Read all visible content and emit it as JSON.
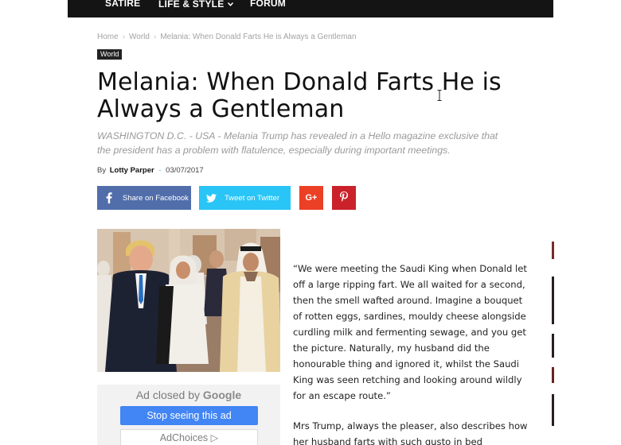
{
  "nav": {
    "items": [
      {
        "label": "SATIRE"
      },
      {
        "label": "LIFE & STYLE"
      },
      {
        "label": "FORUM"
      }
    ]
  },
  "breadcrumb": {
    "items": [
      "Home",
      "World",
      "Melania: When Donald Farts He is Always a Gentleman"
    ],
    "separator": "›"
  },
  "category": "World",
  "article": {
    "title": "Melania: When Donald Farts He is Always a Gentleman",
    "subtitle": "WASHINGTON D.C. - USA - Melania Trump has revealed in a Hello magazine exclusive that the president has a problem with flatulence, especially during important meetings.",
    "by_label": "By",
    "author": "Lotty Parper",
    "date_separator": "-",
    "date": "03/07/2017",
    "paragraphs": [
      "“We were meeting the Saudi King when Donald let off a large ripping fart. We all waited for a second, then the smell wafted around. Imagine a bouquet of rotten eggs, sardines, mouldy cheese alongside curdling milk and fermenting sewage, and you get the picture. Naturally, my husband did the honourable thing and ignored it, whilst the Saudi King was seen retching and looking around wildly for an escape route.”",
      "Mrs Trump, always the pleaser, also describes how her husband farts with such gusto in bed"
    ]
  },
  "share": {
    "facebook": "Share on Facebook",
    "twitter": "Tweet on Twitter",
    "googleplus": "G+"
  },
  "ad": {
    "closed_prefix": "Ad closed by",
    "closed_brand": "Google",
    "stop_button": "Stop seeing this ad",
    "adchoices": "AdChoices ▷"
  },
  "colors": {
    "nav_bg": "#141414",
    "facebook": "#516eab",
    "twitter": "#29c5f6",
    "googleplus": "#eb4026",
    "pinterest": "#ca212a",
    "ad_button": "#4285f4"
  }
}
